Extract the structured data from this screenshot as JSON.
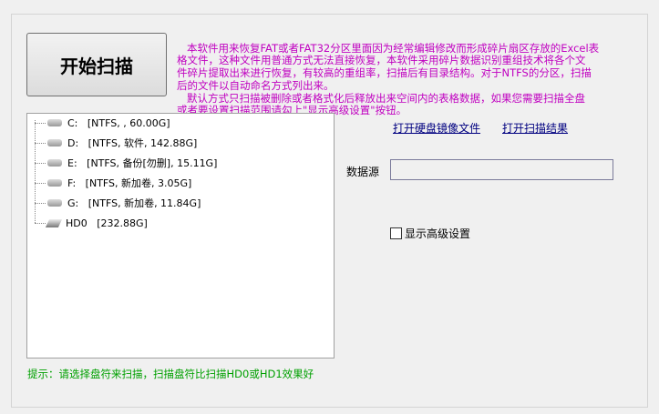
{
  "start_button": "开始扫描",
  "description_lines": [
    "   本软件用来恢复FAT或者FAT32分区里面因为经常编辑修改而形成碎片扇区存放的Excel表",
    "格文件，这种文件用普通方式无法直接恢复，本软件采用碎片数据识别重组技术将各个文",
    "件碎片提取出来进行恢复，有较高的重组率，扫描后有目录结构。对于NTFS的分区，扫描",
    "后的文件以自动命名方式列出来。",
    "   默认方式只扫描被删除或者格式化后释放出来空间内的表格数据，如果您需要扫描全盘",
    "或者要设置扫描范围请勾上\"显示高级设置\"按钮。"
  ],
  "tree": [
    {
      "label": "C:   [NTFS, , 60.00G]",
      "icon": "drive-icon"
    },
    {
      "label": "D:   [NTFS, 软件, 142.88G]",
      "icon": "drive-icon"
    },
    {
      "label": "E:   [NTFS, 备份[勿删], 15.11G]",
      "icon": "drive-icon"
    },
    {
      "label": "F:   [NTFS, 新加卷, 3.05G]",
      "icon": "drive-icon"
    },
    {
      "label": "G:   [NTFS, 新加卷, 11.84G]",
      "icon": "drive-icon"
    },
    {
      "label": "HD0   [232.88G]",
      "icon": "harddisk-icon"
    }
  ],
  "hint": "提示：请选择盘符来扫描，扫描盘符比扫描HD0或HD1效果好",
  "links": {
    "open_image": "打开硬盘镜像文件",
    "open_result": "打开扫描结果"
  },
  "data_source_label": "数据源",
  "data_source_value": "",
  "advanced_checkbox": "显示高级设置"
}
